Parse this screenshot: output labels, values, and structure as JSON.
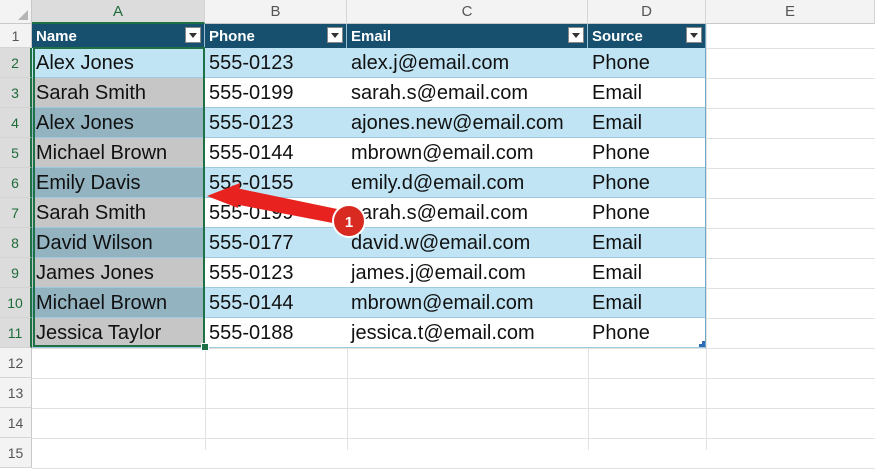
{
  "columns": [
    "A",
    "B",
    "C",
    "D",
    "E"
  ],
  "rows": [
    "1",
    "2",
    "3",
    "4",
    "5",
    "6",
    "7",
    "8",
    "9",
    "10",
    "11",
    "12",
    "13",
    "14",
    "15"
  ],
  "table": {
    "headers": [
      "Name",
      "Phone",
      "Email",
      "Source"
    ],
    "data": [
      [
        "Alex Jones",
        "555-0123",
        "alex.j@email.com",
        "Phone"
      ],
      [
        "Sarah Smith",
        "555-0199",
        "sarah.s@email.com",
        "Email"
      ],
      [
        "Alex Jones",
        "555-0123",
        "ajones.new@email.com",
        "Email"
      ],
      [
        "Michael Brown",
        "555-0144",
        "mbrown@email.com",
        "Phone"
      ],
      [
        "Emily Davis",
        "555-0155",
        "emily.d@email.com",
        "Phone"
      ],
      [
        "Sarah Smith",
        "555-0199",
        "sarah.s@email.com",
        "Phone"
      ],
      [
        "David Wilson",
        "555-0177",
        "david.w@email.com",
        "Email"
      ],
      [
        "James Jones",
        "555-0123",
        "james.j@email.com",
        "Email"
      ],
      [
        "Michael Brown",
        "555-0144",
        "mbrown@email.com",
        "Email"
      ],
      [
        "Jessica Taylor",
        "555-0188",
        "jessica.t@email.com",
        "Phone"
      ]
    ]
  },
  "selected_column": "A",
  "annotation": {
    "badge": "1"
  },
  "colors": {
    "header_bg": "#17506f",
    "band_light": "#c0e4f3",
    "band_white": "#ffffff",
    "selected_light": "#c6c6c6",
    "selected_dark": "#93b3c1",
    "selection_border": "#1e7145",
    "arrow": "#e8231f"
  }
}
